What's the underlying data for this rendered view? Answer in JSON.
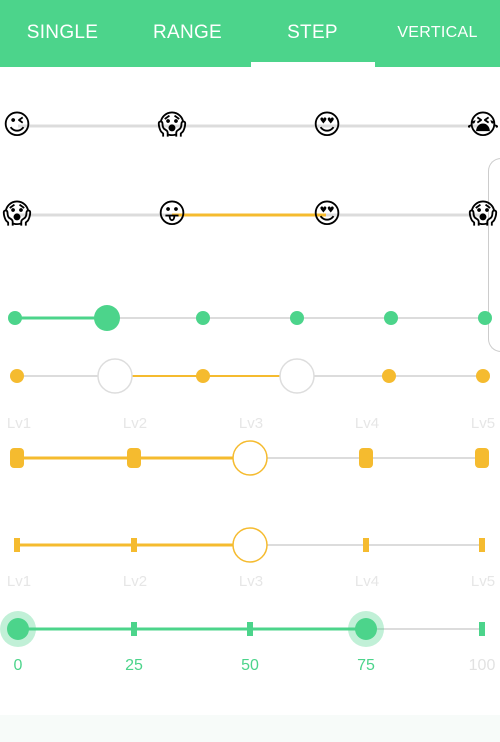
{
  "tabs": [
    {
      "label": "SINGLE"
    },
    {
      "label": "RANGE"
    },
    {
      "label": "STEP"
    },
    {
      "label": "VERTICAL"
    }
  ],
  "active_tab": "STEP",
  "emoji_sliders": {
    "row1": {
      "thumbs": [
        {
          "icon": "wink-smile-icon"
        },
        {
          "icon": "scream-mask-icon"
        },
        {
          "icon": "heart-eyes-icon"
        },
        {
          "icon": "crying-icon"
        }
      ],
      "progress_stop": 1
    },
    "row2": {
      "thumbs": [
        {
          "icon": "scream-mask-icon"
        },
        {
          "icon": "tongue-out-icon"
        },
        {
          "icon": "heart-eyes-icon"
        },
        {
          "icon": "scream-mask-icon"
        }
      ],
      "range": [
        0,
        3
      ]
    }
  },
  "step_sliders": {
    "green_dots": {
      "steps": 5,
      "value_step": 1,
      "color": "#4cd48b"
    },
    "yellow_range": {
      "steps": 5,
      "range": [
        1,
        3
      ],
      "color": "#f5bb2f"
    }
  },
  "level_labels": [
    "Lv1",
    "Lv2",
    "Lv3",
    "Lv4",
    "Lv5"
  ],
  "level_sliders": {
    "pill_slider": {
      "value_step": 2,
      "color": "#f5bb2f"
    },
    "tick_slider": {
      "value_step": 2,
      "color": "#f5bb2f"
    }
  },
  "number_slider": {
    "labels": [
      "0",
      "25",
      "50",
      "75",
      "100"
    ],
    "range": [
      0,
      75
    ],
    "color": "#4cd48b"
  },
  "colors": {
    "green": "#4cd48b",
    "yellow": "#f5bb2f",
    "track": "#dcdcdc",
    "red": "#ef5b43"
  }
}
